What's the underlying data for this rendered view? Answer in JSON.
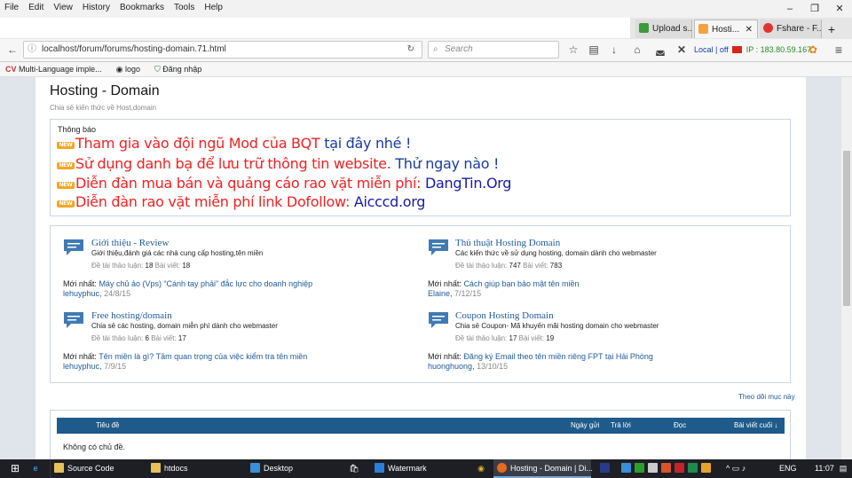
{
  "menu": [
    "File",
    "Edit",
    "View",
    "History",
    "Bookmarks",
    "Tools",
    "Help"
  ],
  "window_controls": [
    "–",
    "❐",
    "✕"
  ],
  "tabs": [
    {
      "label": "Upload s...",
      "icon": "upload-favicon",
      "color": "#3c9b3c"
    },
    {
      "label": "Hosti...",
      "icon": "forum-favicon",
      "color": "#f2a33a",
      "close": "✕"
    },
    {
      "label": "Fshare - F...",
      "icon": "fshare-favicon",
      "color": "#e23333"
    }
  ],
  "new_tab": "+",
  "nav": {
    "url": "localhost/forum/forums/hosting-domain.71.html",
    "search_placeholder": "Search",
    "local_off": "Local | off",
    "ip": "IP : 183.80.59.167"
  },
  "bookmarks": [
    "Multi-Language imple...",
    "logo",
    "Đăng nhập"
  ],
  "page": {
    "title": "Hosting - Domain",
    "subtitle": "Chia sẻ kiến thức về Host,domain"
  },
  "notice": {
    "label": "Thông báo",
    "badge": "NEW",
    "lines": [
      {
        "text": "Tham gia vào đội ngũ Mod của BQT ",
        "link": "tại đây nhé !"
      },
      {
        "text": "Sử dụng danh bạ để lưu trữ thông tin website. ",
        "link": "Thử ngay nào !"
      },
      {
        "text": "Diễn đàn mua bán và quảng cáo rao vặt miễn phí: ",
        "link": "DangTin.Org"
      },
      {
        "text": "Diễn đàn rao vặt miễn phí link Dofollow: ",
        "link": "Aicccd.org"
      }
    ]
  },
  "forums": [
    {
      "title": "Giới thiệu - Review",
      "desc": "Giới thiệu,đánh giá các nhà cung cấp hosting,tên miền",
      "threads_label": "Đề tài thảo luận:",
      "threads": "18",
      "posts_label": "Bài viết:",
      "posts": "18",
      "latest_label": "Mới nhất:",
      "latest": "Máy chủ ảo (Vps) “Cánh tay phải” đắc lực cho doanh nghiệp",
      "by": "lehuyphuc",
      "date": "24/8/15"
    },
    {
      "title": "Thủ thuật Hosting Domain",
      "desc": "Các kiến thức về sử dụng hosting, domain dành cho webmaster",
      "threads_label": "Đề tài thảo luận:",
      "threads": "747",
      "posts_label": "Bài viết:",
      "posts": "783",
      "latest_label": "Mới nhất:",
      "latest": "Cách giúp bạn bảo mật tên miền",
      "by": "Elaine",
      "date": "7/12/15"
    },
    {
      "title": "Free hosting/domain",
      "desc": "Chia sẻ các hosting, domain miễn phí dành cho webmaster",
      "threads_label": "Đề tài thảo luận:",
      "threads": "6",
      "posts_label": "Bài viết:",
      "posts": "17",
      "latest_label": "Mới nhất:",
      "latest": "Tên miền là gì? Tầm quan trọng của việc kiểm tra tên miền",
      "by": "lehuyphuc",
      "date": "7/9/15"
    },
    {
      "title": "Coupon Hosting Domain",
      "desc": "Chia sẻ Coupon- Mã khuyến mãi hosting domain cho webmaster",
      "threads_label": "Đề tài thảo luận:",
      "threads": "17",
      "posts_label": "Bài viết:",
      "posts": "19",
      "latest_label": "Mới nhất:",
      "latest": "Đăng ký Email theo tên miền riêng FPT tại Hải Phòng",
      "by": "huonghuong",
      "date": "13/10/15"
    }
  ],
  "follow": "Theo dõi mục này",
  "thread_table": {
    "headers": {
      "title": "Tiêu đề",
      "date": "Ngày gửi",
      "replies": "Trả lời",
      "views": "Đọc",
      "last": "Bài viết cuối ↓"
    },
    "empty": "Không có chủ đề."
  },
  "taskbar": {
    "items": [
      {
        "label": "Source Code",
        "color": "#e8c15a"
      },
      {
        "label": "htdocs",
        "color": "#e8c15a"
      },
      {
        "label": "Desktop",
        "color": "#3b8fd6"
      },
      {
        "label": "Watermark",
        "color": "#2c7fd8"
      },
      {
        "label": "Hosting - Domain | Di...",
        "color": "#e66a1f"
      }
    ],
    "lang": "ENG",
    "time": "11:07"
  }
}
